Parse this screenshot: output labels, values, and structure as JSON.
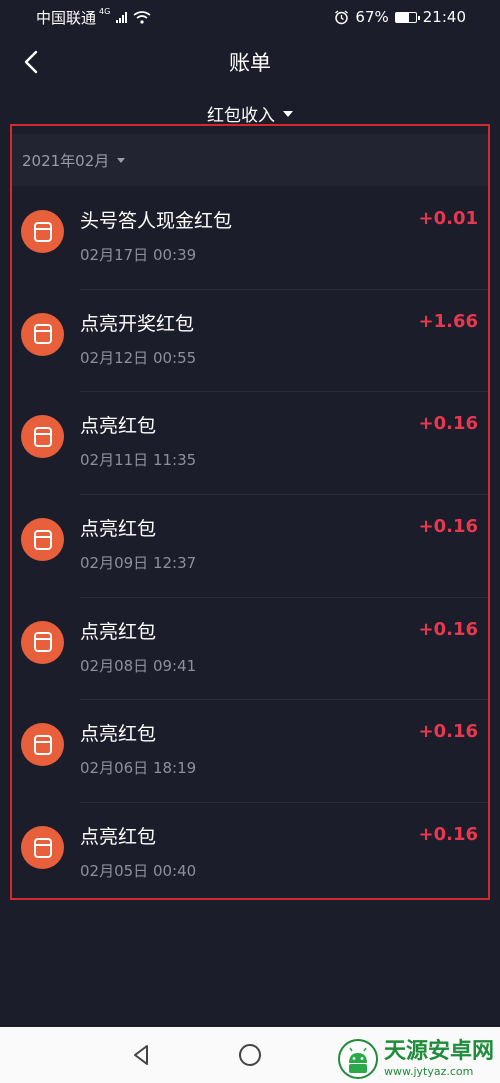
{
  "status_bar": {
    "carrier": "中国联通",
    "network": "4G",
    "battery": "67%",
    "battery_level": 0.67,
    "time": "21:40"
  },
  "header": {
    "title": "账单",
    "back_icon": "chevron-left-icon"
  },
  "filter": {
    "label": "红包收入"
  },
  "month": {
    "label": "2021年02月"
  },
  "colors": {
    "background": "#1c1d2a",
    "avatar": "#e8603b",
    "amount": "#e8384f",
    "highlight": "#d4282f"
  },
  "records": [
    {
      "title": "头号答人现金红包",
      "time": "02月17日 00:39",
      "amount": "+0.01"
    },
    {
      "title": "点亮开奖红包",
      "time": "02月12日 00:55",
      "amount": "+1.66"
    },
    {
      "title": "点亮红包",
      "time": "02月11日 11:35",
      "amount": "+0.16"
    },
    {
      "title": "点亮红包",
      "time": "02月09日 12:37",
      "amount": "+0.16"
    },
    {
      "title": "点亮红包",
      "time": "02月08日 09:41",
      "amount": "+0.16"
    },
    {
      "title": "点亮红包",
      "time": "02月06日 18:19",
      "amount": "+0.16"
    },
    {
      "title": "点亮红包",
      "time": "02月05日 00:40",
      "amount": "+0.16"
    }
  ],
  "watermark": {
    "name": "天源安卓网",
    "url": "www.jytyaz.com"
  }
}
